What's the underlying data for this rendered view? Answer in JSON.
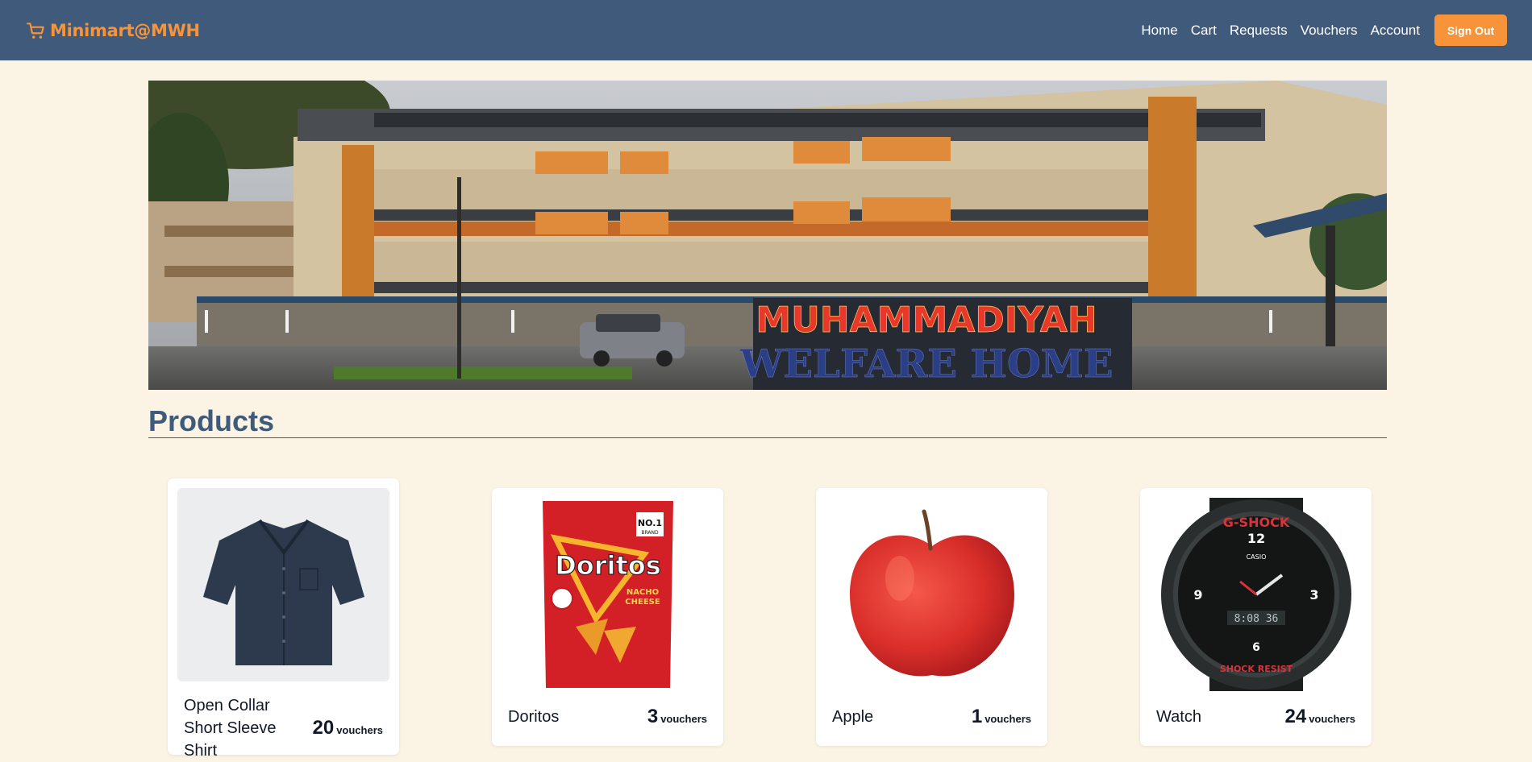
{
  "brand": {
    "name": "Minimart@MWH",
    "icon": "shopping-cart-icon",
    "color": "#f7943a"
  },
  "nav": {
    "links": [
      "Home",
      "Cart",
      "Requests",
      "Vouchers",
      "Account"
    ],
    "signout_label": "Sign Out",
    "background": "#3f5a7b"
  },
  "banner": {
    "sign_line1": "MUHAMMADIYAH",
    "sign_line2": "WELFARE HOME"
  },
  "products": {
    "title": "Products",
    "items": [
      {
        "name": "Open Collar Short Sleeve Shirt",
        "price": "20",
        "unit": "vouchers",
        "image": "shirt-image"
      },
      {
        "name": "Doritos",
        "price": "3",
        "unit": "vouchers",
        "image": "doritos-bag-image",
        "bag_brand": "Doritos",
        "bag_flavor_1": "NACHO",
        "bag_flavor_2": "CHEESE",
        "bag_badge_1": "NO.1",
        "bag_badge_2": "BRAND"
      },
      {
        "name": "Apple",
        "price": "1",
        "unit": "vouchers",
        "image": "apple-image"
      },
      {
        "name": "Watch",
        "price": "24",
        "unit": "vouchers",
        "image": "watch-image",
        "watch_brand": "G-SHOCK",
        "watch_sub": "CASIO",
        "watch_bottom": "SHOCK RESIST",
        "watch_digits": "8:08 36",
        "watch_12": "12",
        "watch_3": "3",
        "watch_9": "9",
        "watch_6": "6"
      }
    ]
  }
}
